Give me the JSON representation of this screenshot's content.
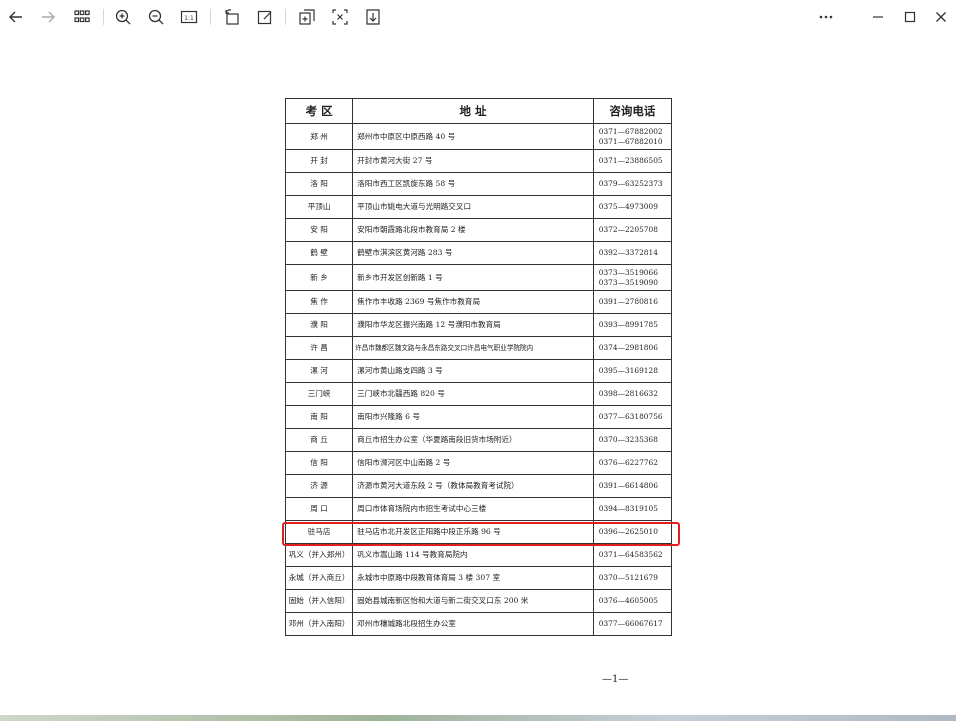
{
  "toolbar": {
    "icons": [
      "back-arrow",
      "forward-arrow",
      "thumbnails",
      "zoom-in",
      "zoom-out",
      "actual-size",
      "rotate",
      "edit",
      "add",
      "fit",
      "download",
      "more",
      "minimize",
      "maximize",
      "close"
    ],
    "actual_size_label": "1:1"
  },
  "table": {
    "headers": [
      "考  区",
      "地        址",
      "咨询电话"
    ],
    "rows": [
      {
        "area": "郑    州",
        "address": "郑州市中原区中原西路 40 号",
        "tel": [
          "0371—67882002",
          "0371—67882010"
        ]
      },
      {
        "area": "开    封",
        "address": "开封市黄河大街 27 号",
        "tel": [
          "0371—23886505"
        ]
      },
      {
        "area": "洛    阳",
        "address": "洛阳市西工区凯旋东路 58 号",
        "tel": [
          "0379—63252373"
        ]
      },
      {
        "area": "平顶山",
        "address": "平顶山市姚电大道与光明路交叉口",
        "tel": [
          "0375—4973009"
        ]
      },
      {
        "area": "安    阳",
        "address": "安阳市朝霞路北段市教育局 2 楼",
        "tel": [
          "0372—2205708"
        ]
      },
      {
        "area": "鹤    壁",
        "address": "鹤壁市淇滨区黄河路 283 号",
        "tel": [
          "0392—3372814"
        ]
      },
      {
        "area": "新    乡",
        "address": "新乡市开发区创新路 1 号",
        "tel": [
          "0373—3519066",
          "0373—3519090"
        ]
      },
      {
        "area": "焦    作",
        "address": "焦作市丰收路 2369 号焦作市教育局",
        "tel": [
          "0391—2780816"
        ]
      },
      {
        "area": "濮    阳",
        "address": "濮阳市华龙区振兴南路 12 号濮阳市教育局",
        "tel": [
          "0393—8991785"
        ]
      },
      {
        "area": "许    昌",
        "address": "许昌市魏都区魏文路与永昌东路交叉口许昌电气职业学院院内",
        "tel": [
          "0374—2981806"
        ]
      },
      {
        "area": "漯    河",
        "address": "漯河市黄山路支四路 3 号",
        "tel": [
          "0395—3169128"
        ]
      },
      {
        "area": "三门峡",
        "address": "三门峡市北疆西路 820 号",
        "tel": [
          "0398—2816632"
        ]
      },
      {
        "area": "南    阳",
        "address": "南阳市兴隆路 6 号",
        "tel": [
          "0377—63180756"
        ]
      },
      {
        "area": "商    丘",
        "address": "商丘市招生办公室（华夏路南段旧货市场附近）",
        "tel": [
          "0370—3235368"
        ]
      },
      {
        "area": "信    阳",
        "address": "信阳市浉河区中山南路 2 号",
        "tel": [
          "0376—6227762"
        ]
      },
      {
        "area": "济    源",
        "address": "济源市黄河大道东段 2 号（教体局教育考试院）",
        "tel": [
          "0391—6614806"
        ]
      },
      {
        "area": "周    口",
        "address": "周口市体育场院内市招生考试中心三楼",
        "tel": [
          "0394—8319105"
        ]
      },
      {
        "area": "驻马店",
        "address": "驻马店市北开发区正阳路中段正乐路 96 号",
        "tel": [
          "0396—2625010"
        ],
        "highlighted": true
      },
      {
        "area": "巩义（并入郑州）",
        "address": "巩义市嵩山路 114 号教育局院内",
        "tel": [
          "0371—64583562"
        ]
      },
      {
        "area": "永城（并入商丘）",
        "address": "永城市中原路中段教育体育局 3 楼 307 室",
        "tel": [
          "0370—5121679"
        ]
      },
      {
        "area": "固始（并入信阳）",
        "address": "固始县城南新区怡和大道与新二街交叉口东 200 米",
        "tel": [
          "0376—4605005"
        ]
      },
      {
        "area": "邓州（并入南阳）",
        "address": "邓州市穰城路北段招生办公室",
        "tel": [
          "0377—66067617"
        ]
      }
    ]
  },
  "page_number": "—1—",
  "colors": {
    "highlight": "#e02020",
    "border": "#333333"
  }
}
